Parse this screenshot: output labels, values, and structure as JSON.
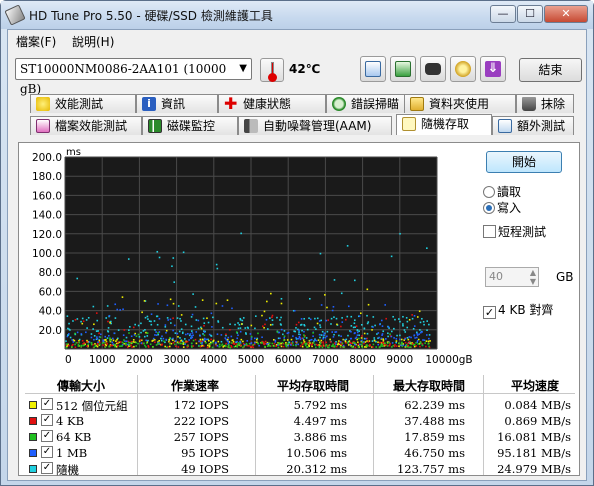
{
  "window": {
    "title": "HD Tune Pro 5.50 - 硬碟/SSD 檢測維護工具"
  },
  "menu": [
    {
      "label": "檔案(F)"
    },
    {
      "label": "說明(H)"
    }
  ],
  "toolbar": {
    "drive": "ST10000NM0086-2AA101 (10000 gB)",
    "temperature": "42℃",
    "exit_label": "結束",
    "icons": [
      "copy-icon",
      "copy-info-icon",
      "camera-icon",
      "settings-icon",
      "download-icon"
    ]
  },
  "tabs_row1": [
    {
      "label": "效能測試",
      "icon": "bulb-icon"
    },
    {
      "label": "資訊",
      "icon": "info-icon"
    },
    {
      "label": "健康狀態",
      "icon": "health-cross-icon"
    },
    {
      "label": "錯誤掃瞄",
      "icon": "magnifier-icon"
    },
    {
      "label": "資料夾使用",
      "icon": "folder-icon"
    },
    {
      "label": "抹除",
      "icon": "trash-icon"
    }
  ],
  "tabs_row2": [
    {
      "label": "檔案效能測試",
      "icon": "file-bulb-icon"
    },
    {
      "label": "磁碟監控",
      "icon": "chart-icon"
    },
    {
      "label": "自動噪聲管理(AAM)",
      "icon": "speaker-icon"
    },
    {
      "label": "隨機存取",
      "icon": "random-access-icon",
      "active": true
    },
    {
      "label": "額外測試",
      "icon": "extra-test-icon"
    }
  ],
  "side": {
    "start_label": "開始",
    "read_label": "讀取",
    "write_label": "寫入",
    "mode": "write",
    "short_test_label": "短程測試",
    "short_test_checked": false,
    "short_test_value": "40",
    "gb_label": "GB",
    "align_label": "4 KB 對齊",
    "align_checked": true
  },
  "chart_data": {
    "type": "scatter",
    "ylabel": "ms",
    "xlabel": "",
    "x_ticks": [
      "0",
      "1000",
      "2000",
      "3000",
      "4000",
      "5000",
      "6000",
      "7000",
      "8000",
      "9000",
      "10000gB"
    ],
    "y_ticks": [
      "20.0",
      "40.0",
      "60.0",
      "80.0",
      "100.0",
      "120.0",
      "140.0",
      "160.0",
      "180.0",
      "200.0"
    ],
    "xlim": [
      0,
      10000
    ],
    "ylim": [
      0,
      200
    ],
    "grid": true,
    "series": [
      {
        "name": "512 個位元組",
        "color": "#f0f000",
        "avg_ms": 5.792,
        "max_ms": 62.239
      },
      {
        "name": "4 KB",
        "color": "#e01010",
        "avg_ms": 4.497,
        "max_ms": 37.488
      },
      {
        "name": "64 KB",
        "color": "#20c020",
        "avg_ms": 3.886,
        "max_ms": 17.859
      },
      {
        "name": "1 MB",
        "color": "#2060ff",
        "avg_ms": 10.506,
        "max_ms": 46.75
      },
      {
        "name": "隨機",
        "color": "#20d0e0",
        "avg_ms": 20.312,
        "max_ms": 123.757
      }
    ]
  },
  "results": {
    "headers": [
      "傳輸大小",
      "作業速率",
      "平均存取時間",
      "最大存取時間",
      "平均速度"
    ],
    "rows": [
      {
        "size": "512 個位元組",
        "rate": "172 IOPS",
        "avg": "5.792 ms",
        "max": "62.239 ms",
        "speed": "0.084 MB/s",
        "color": "#f0f000"
      },
      {
        "size": "4 KB",
        "rate": "222 IOPS",
        "avg": "4.497 ms",
        "max": "37.488 ms",
        "speed": "0.869 MB/s",
        "color": "#e01010"
      },
      {
        "size": "64 KB",
        "rate": "257 IOPS",
        "avg": "3.886 ms",
        "max": "17.859 ms",
        "speed": "16.081 MB/s",
        "color": "#20c020"
      },
      {
        "size": "1 MB",
        "rate": "95 IOPS",
        "avg": "10.506 ms",
        "max": "46.750 ms",
        "speed": "95.181 MB/s",
        "color": "#2060ff"
      },
      {
        "size": "隨機",
        "rate": "49 IOPS",
        "avg": "20.312 ms",
        "max": "123.757 ms",
        "speed": "24.979 MB/s",
        "color": "#20d0e0"
      }
    ]
  }
}
